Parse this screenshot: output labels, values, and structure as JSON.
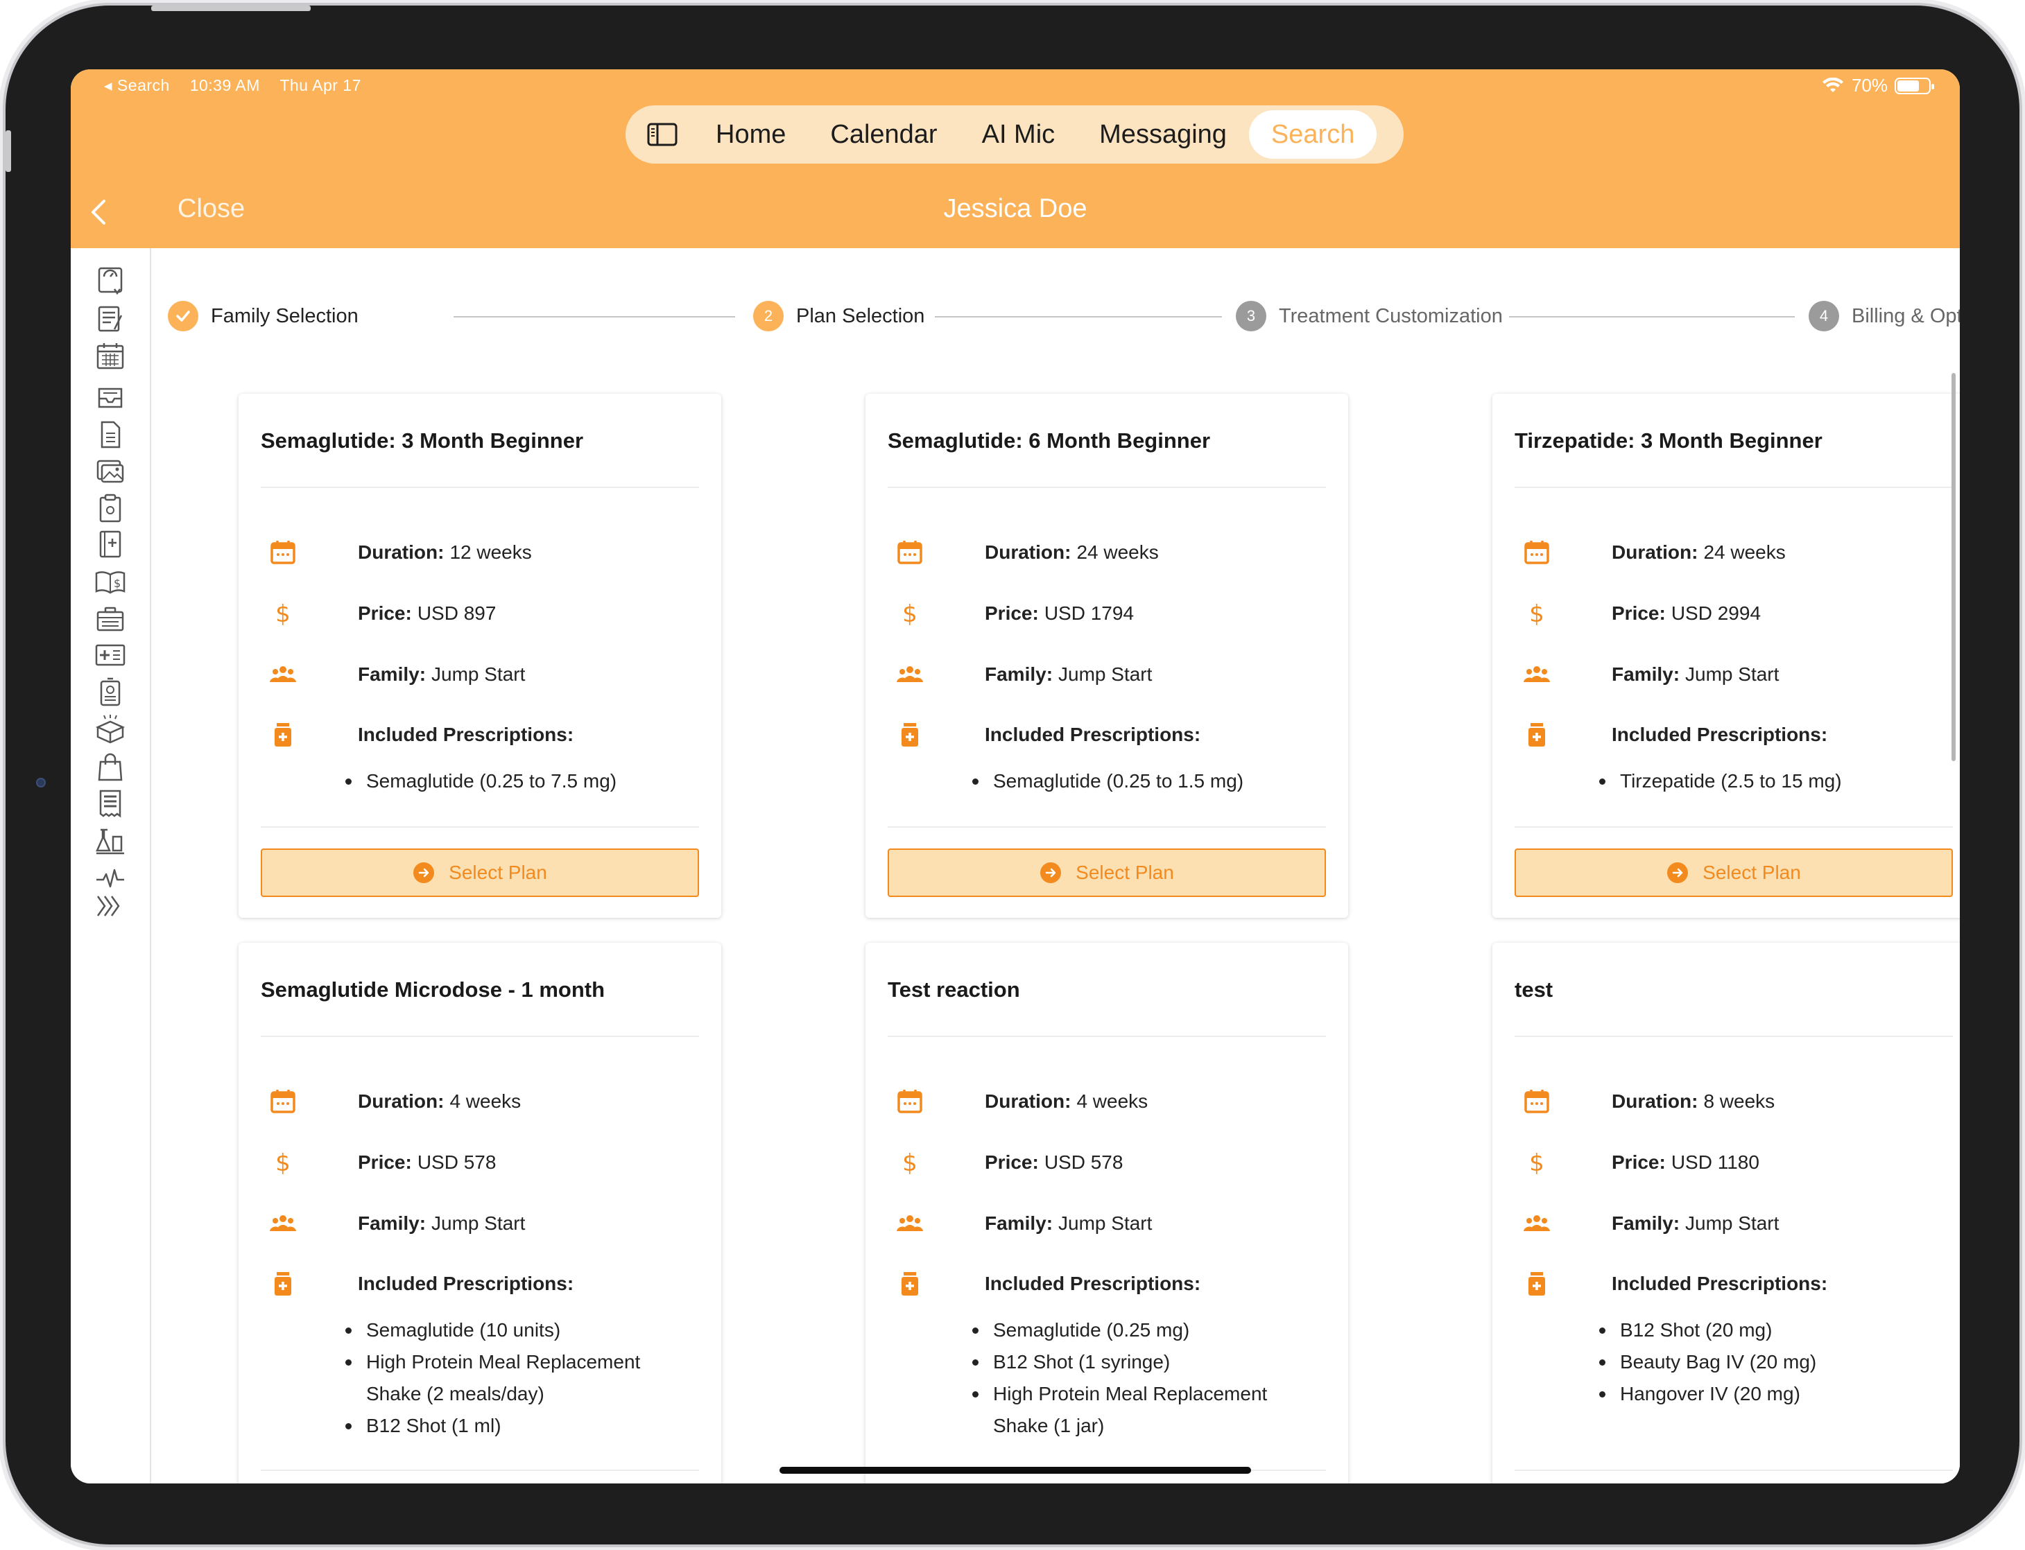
{
  "status_bar": {
    "back_app": "◂ Search",
    "time": "10:39 AM",
    "date": "Thu Apr 17",
    "battery": "70%",
    "battery_level": 0.7
  },
  "topnav": {
    "sidebar_toggle_icon": "sidebar-toggle-icon",
    "items": [
      {
        "label": "Home"
      },
      {
        "label": "Calendar"
      },
      {
        "label": "AI Mic"
      },
      {
        "label": "Messaging"
      },
      {
        "label": "Search",
        "active": true
      }
    ]
  },
  "title_bar": {
    "close_label": "Close",
    "patient_name": "Jessica Doe"
  },
  "sidebar": {
    "icons": [
      "scale-icon",
      "notes-icon",
      "calendar-icon",
      "inbox-icon",
      "document-icon",
      "photos-icon",
      "clipboard-icon",
      "medical-book-icon",
      "billing-book-icon",
      "briefcase-icon",
      "id-card-icon",
      "badge-icon",
      "box-icon",
      "shopping-bag-icon",
      "receipt-icon",
      "lab-icon",
      "vitals-icon",
      "expand-icon"
    ]
  },
  "stepper": {
    "steps": [
      {
        "number": "1",
        "label": "Family Selection",
        "state": "done"
      },
      {
        "number": "2",
        "label": "Plan Selection",
        "state": "current"
      },
      {
        "number": "3",
        "label": "Treatment Customization",
        "state": "pending"
      },
      {
        "number": "4",
        "label": "Billing & Options",
        "state": "pending"
      }
    ]
  },
  "labels": {
    "duration": "Duration:",
    "price": "Price:",
    "family": "Family:",
    "prescriptions": "Included Prescriptions:",
    "select_plan": "Select Plan"
  },
  "plans": [
    {
      "title": "Semaglutide: 3 Month Beginner",
      "duration": "12 weeks",
      "price": "USD 897",
      "family": "Jump Start",
      "prescriptions": [
        "Semaglutide (0.25 to 7.5 mg)"
      ]
    },
    {
      "title": "Semaglutide: 6 Month Beginner",
      "duration": "24 weeks",
      "price": "USD 1794",
      "family": "Jump Start",
      "prescriptions": [
        "Semaglutide (0.25 to 1.5 mg)"
      ]
    },
    {
      "title": "Tirzepatide: 3 Month Beginner",
      "duration": "24 weeks",
      "price": "USD 2994",
      "family": "Jump Start",
      "prescriptions": [
        "Tirzepatide (2.5 to 15 mg)"
      ]
    },
    {
      "title": "Semaglutide Microdose - 1 month",
      "duration": "4 weeks",
      "price": "USD 578",
      "family": "Jump Start",
      "prescriptions": [
        "Semaglutide (10 units)",
        "High Protein Meal Replacement Shake (2 meals/day)",
        "B12 Shot (1 ml)"
      ]
    },
    {
      "title": "Test reaction",
      "duration": "4 weeks",
      "price": "USD 578",
      "family": "Jump Start",
      "prescriptions": [
        "Semaglutide (0.25 mg)",
        "B12 Shot (1 syringe)",
        "High Protein Meal Replacement Shake (1 jar)"
      ]
    },
    {
      "title": "test",
      "duration": "8 weeks",
      "price": "USD 1180",
      "family": "Jump Start",
      "prescriptions": [
        "B12 Shot (20 mg)",
        "Beauty Bag IV (20 mg)",
        "Hangover IV (20 mg)"
      ]
    }
  ],
  "colors": {
    "header": "#fbb258",
    "accent": "#f28a1e",
    "button_fill": "#fde0b2"
  }
}
